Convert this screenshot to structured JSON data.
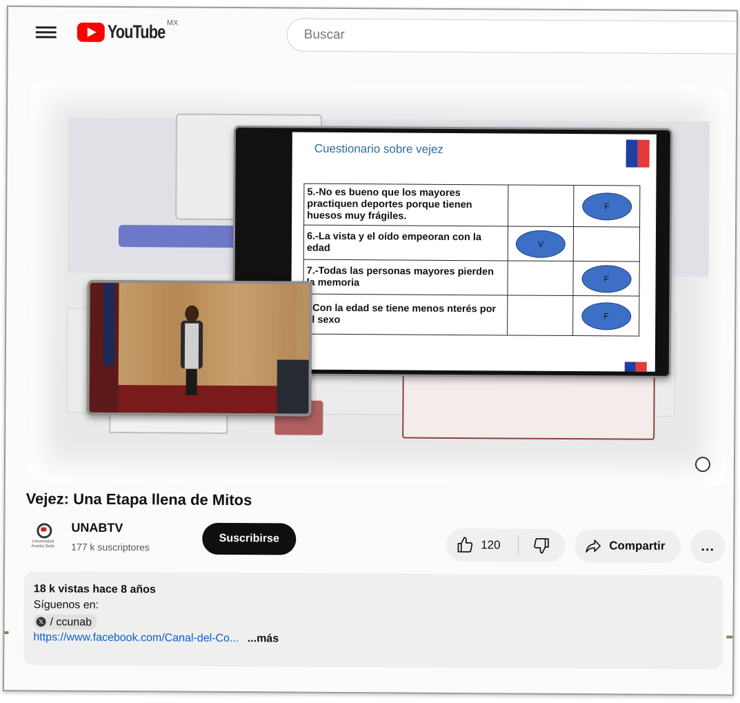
{
  "header": {
    "logo_text": "YouTube",
    "region": "MX",
    "search_placeholder": "Buscar"
  },
  "video": {
    "slide": {
      "title": "Cuestionario sobre vejez",
      "rows": [
        {
          "question": "5.-No es bueno que los mayores practiquen deportes porque tienen huesos muy frágiles.",
          "v": "",
          "f": "F"
        },
        {
          "question": "6.-La vista y el oído empeoran con la edad",
          "v": "V",
          "f": ""
        },
        {
          "question": "7.-Todas las personas mayores pierden la memoria",
          "v": "",
          "f": "F"
        },
        {
          "question": ".-Con la edad se tiene menos nterés por el sexo",
          "v": "",
          "f": "F"
        }
      ]
    }
  },
  "title": "Vejez: Una Etapa llena de Mitos",
  "channel": {
    "name": "UNABTV",
    "subscribers": "177 k suscriptores",
    "subscribe_label": "Suscribirse"
  },
  "actions": {
    "like_count": "120",
    "share_label": "Compartir",
    "more_label": "..."
  },
  "description": {
    "meta": "18 k vistas  hace 8 años",
    "line1": "Síguenos en:",
    "chip_label": "/ ccunab",
    "link": "https://www.facebook.com/Canal-del-Co...",
    "more_label": "...más"
  },
  "colors": {
    "brand_red": "#ff0000",
    "link_blue": "#065fd4",
    "oval_blue": "#3e6fc6"
  }
}
